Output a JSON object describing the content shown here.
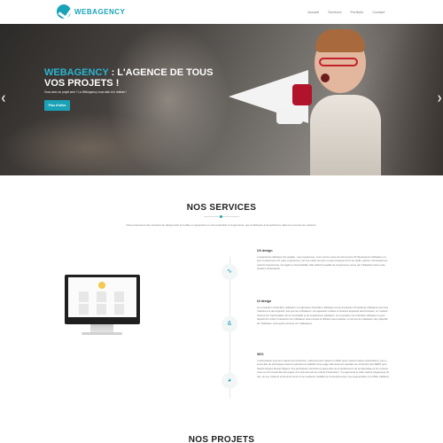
{
  "header": {
    "brand": "WEBAGENCY",
    "nav": [
      "Accueil",
      "Services",
      "Portfolio",
      "Contact"
    ]
  },
  "hero": {
    "title_accent": "WEBAGENCY",
    "title_rest": " : L'AGENCE DE TOUS VOS PROJETS !",
    "subtitle": "Vous avez un projet web ? La Webagency vous aide à le réaliser !",
    "button": "Plus d'infos",
    "prev_icon": "chevron-left-icon",
    "next_icon": "chevron-right-icon"
  },
  "services": {
    "title": "NOS SERVICES",
    "intro": "Nous proposons des services de design web & mobile en apportant un soin particulier à l'ergonomie, qui contribuera à la pertinence dans les sources de visiteurs.",
    "items": [
      {
        "icon": "chart-icon",
        "title": "UX design",
        "text": "L'expérience utilisateur (de anglais : user experience, sous comme sous les acronymes UX (Expérience Utilisateur ou plus couramment UX (user experience), est une notion de plus en plus évoquée de la vie réelle, parfois, fournissant les notions d'ergonomie, les règles à l'accessibilité. Elle définit la qualité de l'expérience vécue par l'utilisateur dans toute situation d'interaction."
      },
      {
        "icon": "ampersand-icon",
        "title": "UI design",
        "text": "La conception d'interface utilisateur ou ingénierie d'interface utilisateur est la conception d'interfaces utilisateur pour des machines et des logiciels, tels que les ordinateurs, les appareils mobiles et d'autres appareils électroniques, en mettant l'accent sur l'optimisation de la convivialité et de l'expérience utilisateur. La conception de l'interface utilisateur a pour objectif de rendre l'interaction de l'utilisateur aussi simple & efficace que possible, en termes de réalisation des objectifs de l'utilisateur (conception centrée sur l'utilisateur)."
      },
      {
        "icon": "pie-chart-icon",
        "title": "SEO",
        "text": "L'optimisation pour les moteurs de recherche, référencement naturel ou SEO (pour search engine optimization), est un ensemble de techniques visant à optimiser la visibilité d'une page web dans les résultats de recherche (les SERP pour Search Engine Result Pages). Ces techniques cherchent à apprendre la compréhension de la thématique & du contenu d'une ou de l'ensemble des pages d'un site web par les robots d'indexation. Il a augmenté le trafic naturel (organique) du site, de ses visiteurs proéminemment à une meilleure visibilité de l'entreprise avec une augmentation du chiffre d'affaires."
      }
    ]
  },
  "projects": {
    "title": "NOS PROJETS"
  },
  "colors": {
    "accent": "#1aa3b8",
    "hero_accent": "#29b6d2"
  }
}
